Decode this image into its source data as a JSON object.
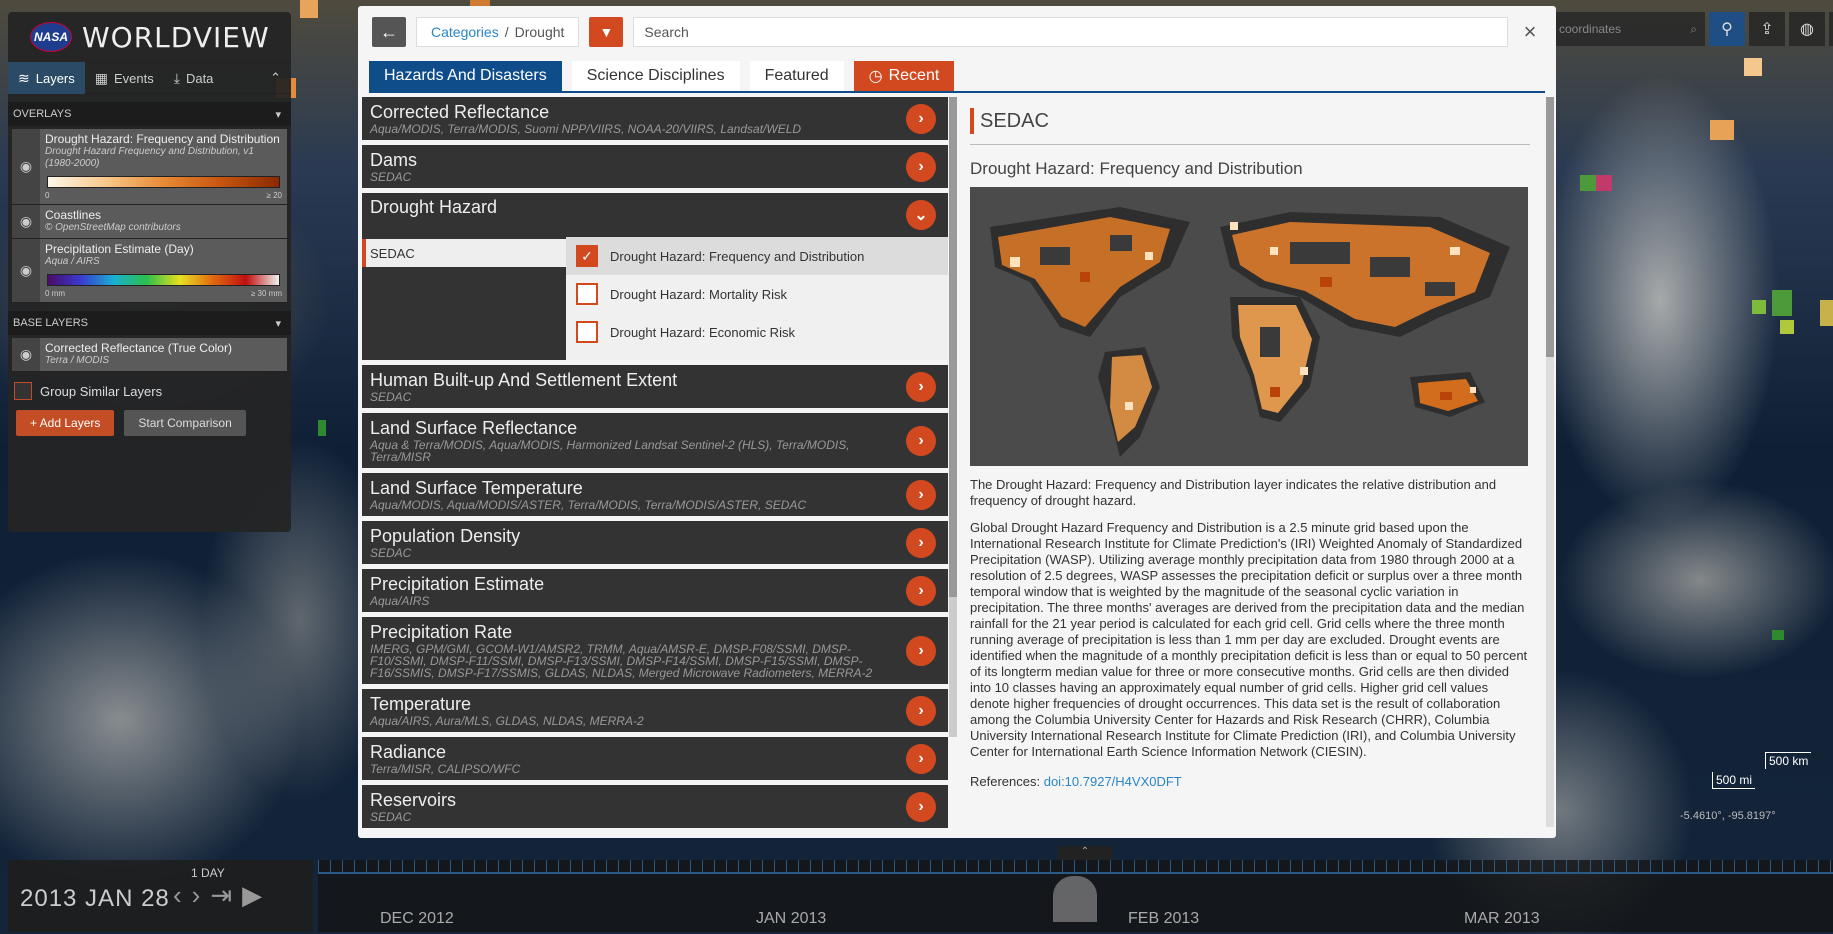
{
  "app": {
    "name": "WORLDVIEW",
    "nasa": "NASA"
  },
  "sidebar": {
    "tabs": [
      {
        "label": "Layers",
        "icon": "layers-icon"
      },
      {
        "label": "Events",
        "icon": "calendar-icon"
      },
      {
        "label": "Data",
        "icon": "download-icon"
      }
    ],
    "overlays_label": "OVERLAYS",
    "overlays": [
      {
        "title": "Drought Hazard: Frequency and Distribution",
        "subtitle": "Drought Hazard Frequency and Distribution, v1 (1980-2000)",
        "min": "0",
        "max": "≥ 20"
      },
      {
        "title": "Coastlines",
        "subtitle": "© OpenStreetMap contributors"
      },
      {
        "title": "Precipitation Estimate (Day)",
        "subtitle": "Aqua / AIRS",
        "min": "0 mm",
        "max": "≥ 30 mm"
      }
    ],
    "base_label": "BASE LAYERS",
    "base": [
      {
        "title": "Corrected Reflectance (True Color)",
        "subtitle": "Terra / MODIS"
      }
    ],
    "group_label": "Group Similar Layers",
    "add_layers": "+ Add Layers",
    "start_comparison": "Start Comparison"
  },
  "topright": {
    "search_placeholder": "er coordinates"
  },
  "map": {
    "scale_km": "500 km",
    "scale_mi": "500 mi",
    "coords": "-5.4610°, -95.8197°"
  },
  "timeline": {
    "date": "2013 JAN 28",
    "interval": "1 DAY",
    "months": [
      {
        "m": "DEC",
        "y": "2012"
      },
      {
        "m": "JAN",
        "y": "2013"
      },
      {
        "m": "FEB",
        "y": "2013"
      },
      {
        "m": "MAR",
        "y": "2013"
      }
    ]
  },
  "modal": {
    "breadcrumb": {
      "root": "Categories",
      "sep": "/",
      "current": "Drought"
    },
    "search_placeholder": "Search",
    "tabs": [
      "Hazards And Disasters",
      "Science Disciplines",
      "Featured"
    ],
    "recent_tab": "Recent",
    "categories_before": [
      {
        "title": "Corrected Reflectance",
        "sub": "Aqua/MODIS, Terra/MODIS, Suomi NPP/VIIRS, NOAA-20/VIIRS, Landsat/WELD"
      },
      {
        "title": "Dams",
        "sub": "SEDAC"
      }
    ],
    "expanded": {
      "title": "Drought Hazard",
      "source": "SEDAC",
      "measurements": [
        {
          "label": "Drought Hazard: Frequency and Distribution",
          "checked": true
        },
        {
          "label": "Drought Hazard: Mortality Risk",
          "checked": false
        },
        {
          "label": "Drought Hazard: Economic Risk",
          "checked": false
        }
      ]
    },
    "categories_after": [
      {
        "title": "Human Built-up And Settlement Extent",
        "sub": "SEDAC"
      },
      {
        "title": "Land Surface Reflectance",
        "sub": "Aqua & Terra/MODIS, Aqua/MODIS, Harmonized Landsat Sentinel-2 (HLS), Terra/MODIS, Terra/MISR"
      },
      {
        "title": "Land Surface Temperature",
        "sub": "Aqua/MODIS, Aqua/MODIS/ASTER, Terra/MODIS, Terra/MODIS/ASTER, SEDAC"
      },
      {
        "title": "Population Density",
        "sub": "SEDAC"
      },
      {
        "title": "Precipitation Estimate",
        "sub": "Aqua/AIRS"
      },
      {
        "title": "Precipitation Rate",
        "sub": "IMERG, GPM/GMI, GCOM-W1/AMSR2, TRMM, Aqua/AMSR-E, DMSP-F08/SSMI, DMSP-F10/SSMI, DMSP-F11/SSMI, DMSP-F13/SSMI, DMSP-F14/SSMI, DMSP-F15/SSMI, DMSP-F16/SSMIS, DMSP-F17/SSMIS, GLDAS, NLDAS, Merged Microwave Radiometers, MERRA-2"
      },
      {
        "title": "Temperature",
        "sub": "Aqua/AIRS, Aura/MLS, GLDAS, NLDAS, MERRA-2"
      },
      {
        "title": "Radiance",
        "sub": "Terra/MISR, CALIPSO/WFC"
      },
      {
        "title": "Reservoirs",
        "sub": "SEDAC"
      }
    ],
    "detail": {
      "source": "SEDAC",
      "title": "Drought Hazard: Frequency and Distribution",
      "p1": "The Drought Hazard: Frequency and Distribution layer indicates the relative distribution and frequency of drought hazard.",
      "p2": "Global Drought Hazard Frequency and Distribution is a 2.5 minute grid based upon the International Research Institute for Climate Prediction's (IRI) Weighted Anomaly of Standardized Precipitation (WASP). Utilizing average monthly precipitation data from 1980 through 2000 at a resolution of 2.5 degrees, WASP assesses the precipitation deficit or surplus over a three month temporal window that is weighted by the magnitude of the seasonal cyclic variation in precipitation. The three months' averages are derived from the precipitation data and the median rainfall for the 21 year period is calculated for each grid cell. Grid cells where the three month running average of precipitation is less than 1 mm per day are excluded. Drought events are identified when the magnitude of a monthly precipitation deficit is less than or equal to 50 percent of its longterm median value for three or more consecutive months. Grid cells are then divided into 10 classes having an approximately equal number of grid cells. Higher grid cell values denote higher frequencies of drought occurrences. This data set is the result of collaboration among the Columbia University Center for Hazards and Risk Research (CHRR), Columbia University International Research Institute for Climate Prediction (IRI), and Columbia University Center for International Earth Science Information Network (CIESIN).",
      "refs_label": "References:",
      "refs_link": "doi:10.7927/H4VX0DFT"
    }
  }
}
